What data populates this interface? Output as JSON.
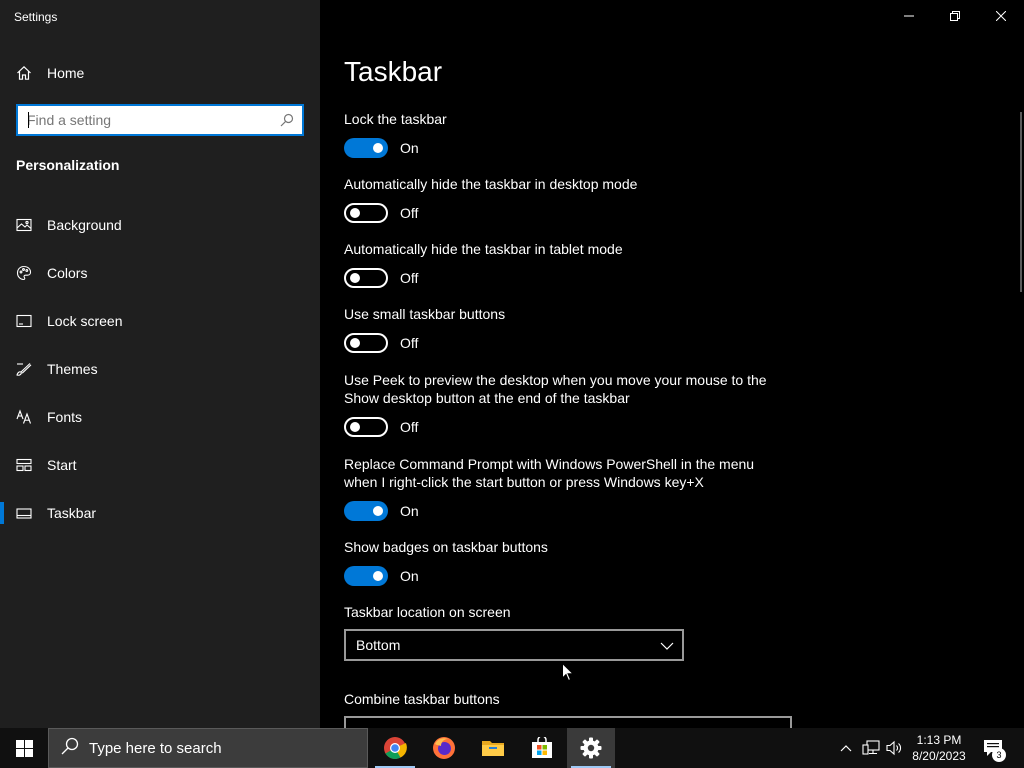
{
  "window": {
    "app_title": "Settings",
    "controls": [
      "minimize",
      "restore",
      "close"
    ]
  },
  "sidebar": {
    "home_label": "Home",
    "search_placeholder": "Find a setting",
    "section_title": "Personalization",
    "items": [
      {
        "label": "Background",
        "icon": "image-icon",
        "selected": false
      },
      {
        "label": "Colors",
        "icon": "palette-icon",
        "selected": false
      },
      {
        "label": "Lock screen",
        "icon": "lock-screen-icon",
        "selected": false
      },
      {
        "label": "Themes",
        "icon": "brush-icon",
        "selected": false
      },
      {
        "label": "Fonts",
        "icon": "font-icon",
        "selected": false
      },
      {
        "label": "Start",
        "icon": "start-grid-icon",
        "selected": false
      },
      {
        "label": "Taskbar",
        "icon": "taskbar-icon",
        "selected": true
      }
    ]
  },
  "main": {
    "title": "Taskbar",
    "settings": [
      {
        "label": "Lock the taskbar",
        "state": "On",
        "on": true
      },
      {
        "label": "Automatically hide the taskbar in desktop mode",
        "state": "Off",
        "on": false
      },
      {
        "label": "Automatically hide the taskbar in tablet mode",
        "state": "Off",
        "on": false
      },
      {
        "label": "Use small taskbar buttons",
        "state": "Off",
        "on": false
      },
      {
        "label": "Use Peek to preview the desktop when you move your mouse to the Show desktop button at the end of the taskbar",
        "state": "Off",
        "on": false
      },
      {
        "label": "Replace Command Prompt with Windows PowerShell in the menu when I right-click the start button or press Windows key+X",
        "state": "On",
        "on": true
      },
      {
        "label": "Show badges on taskbar buttons",
        "state": "On",
        "on": true
      }
    ],
    "location_label": "Taskbar location on screen",
    "location_value": "Bottom",
    "combine_label": "Combine taskbar buttons"
  },
  "taskbar": {
    "search_text": "Type here to search",
    "apps": [
      "chrome-icon",
      "firefox-icon",
      "file-explorer-icon",
      "store-icon",
      "settings-gear-icon"
    ],
    "time": "1:13 PM",
    "date": "8/20/2023",
    "notification_count": "3"
  },
  "colors": {
    "accent": "#0078d7",
    "sidebar_bg": "#1f1f1f",
    "content_bg": "#000000"
  }
}
